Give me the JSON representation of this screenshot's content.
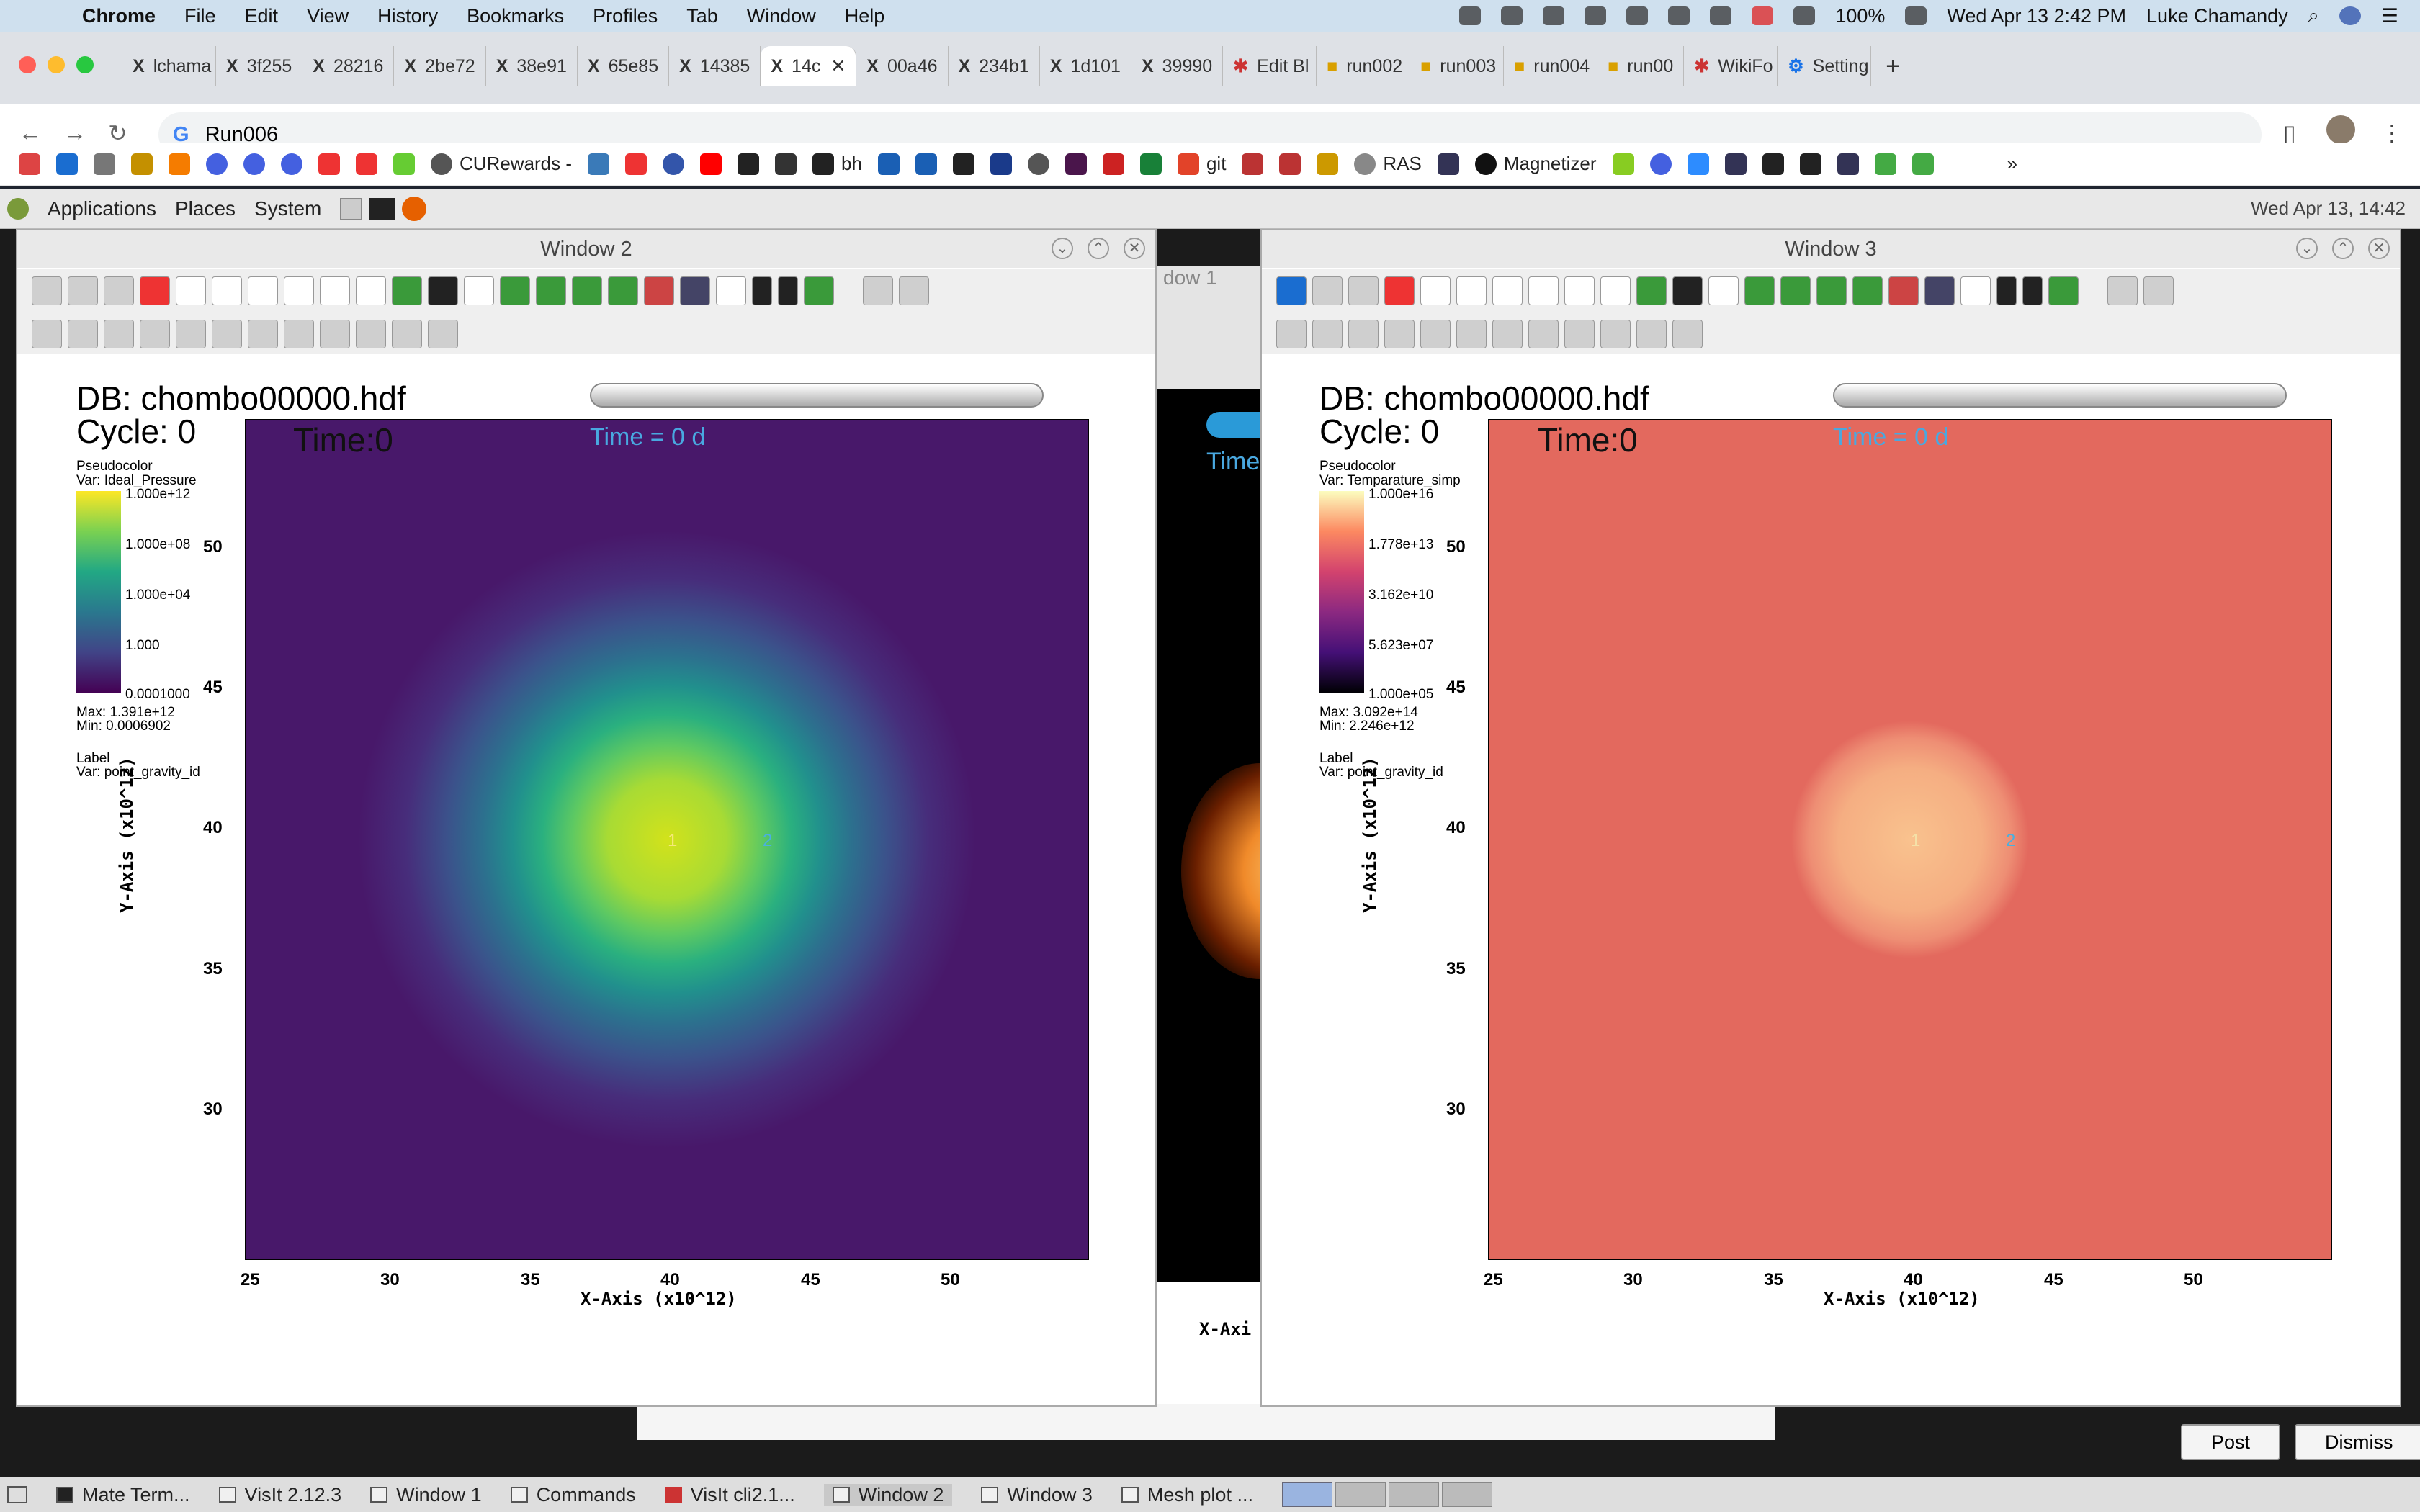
{
  "menubar": {
    "app": "Chrome",
    "items": [
      "File",
      "Edit",
      "View",
      "History",
      "Bookmarks",
      "Profiles",
      "Tab",
      "Window",
      "Help"
    ],
    "battery": "100%",
    "datetime": "Wed Apr 13  2:42 PM",
    "user": "Luke Chamandy"
  },
  "tabs": [
    "lchama",
    "3f255",
    "28216",
    "2be72",
    "38e91",
    "65e85",
    "14385",
    "14c",
    "00a46",
    "234b1",
    "1d101",
    "39990",
    "Edit Bl",
    "run002",
    "run003",
    "run004",
    "run00",
    "WikiFo",
    "Setting"
  ],
  "address": {
    "text": "Run006"
  },
  "bookmarks": [
    "CURewards -",
    "bh",
    "git",
    "RAS",
    "Magnetizer"
  ],
  "gnome": {
    "items": [
      "Applications",
      "Places",
      "System"
    ],
    "clock": "Wed Apr 13, 14:42"
  },
  "behind_window": {
    "title": "dow 1",
    "label": "Time",
    "xaxis": "X-Axi"
  },
  "window2": {
    "title": "Window 2",
    "db": "DB: chombo00000.hdf",
    "cycle": "Cycle: 0",
    "time": "Time:0",
    "time_d": "Time = 0 d",
    "plot_type": "Pseudocolor",
    "var": "Var: Ideal_Pressure",
    "cb_labels": [
      "1.000e+12",
      "1.000e+08",
      "1.000e+04",
      "1.000",
      "0.0001000"
    ],
    "max": "Max:  1.391e+12",
    "min": "Min:  0.0006902",
    "label_title": "Label",
    "label_var": "Var: point_gravity_id",
    "xlabel": "X-Axis  (x10^12)",
    "ylabel": "Y-Axis  (x10^12)",
    "marker1": "1",
    "marker2": "2"
  },
  "window3": {
    "title": "Window 3",
    "db": "DB: chombo00000.hdf",
    "cycle": "Cycle: 0",
    "time": "Time:0",
    "time_d": "Time = 0 d",
    "plot_type": "Pseudocolor",
    "var": "Var: Temparature_simp",
    "cb_labels": [
      "1.000e+16",
      "1.778e+13",
      "3.162e+10",
      "5.623e+07",
      "1.000e+05"
    ],
    "max": "Max:  3.092e+14",
    "min": "Min:  2.246e+12",
    "label_title": "Label",
    "label_var": "Var: point_gravity_id",
    "xlabel": "X-Axis  (x10^12)",
    "ylabel": "Y-Axis  (x10^12)",
    "marker1": "1",
    "marker2": "2"
  },
  "chart_data": [
    {
      "type": "heatmap",
      "xticks": [
        "25",
        "30",
        "35",
        "40",
        "45",
        "50"
      ],
      "yticks": [
        "50",
        "45",
        "40",
        "35",
        "30"
      ],
      "xlabel": "X-Axis  (x10^12)",
      "ylabel": "Y-Axis  (x10^12)",
      "xlim": [
        25,
        55
      ],
      "ylim": [
        25,
        55
      ],
      "colormap": "viridis",
      "peak_center": [
        40,
        40
      ]
    },
    {
      "type": "heatmap",
      "xticks": [
        "25",
        "30",
        "35",
        "40",
        "45",
        "50"
      ],
      "yticks": [
        "50",
        "45",
        "40",
        "35",
        "30"
      ],
      "xlabel": "X-Axis  (x10^12)",
      "ylabel": "Y-Axis  (x10^12)",
      "xlim": [
        25,
        55
      ],
      "ylim": [
        25,
        55
      ],
      "colormap": "magma",
      "peak_center": [
        40,
        40
      ]
    }
  ],
  "dialog": {
    "post": "Post",
    "dismiss": "Dismiss"
  },
  "taskbar": [
    "Mate Term...",
    "VisIt 2.12.3",
    "Window 1",
    "Commands",
    "VisIt cli2.1...",
    "Window 2",
    "Window 3",
    "Mesh plot ..."
  ]
}
